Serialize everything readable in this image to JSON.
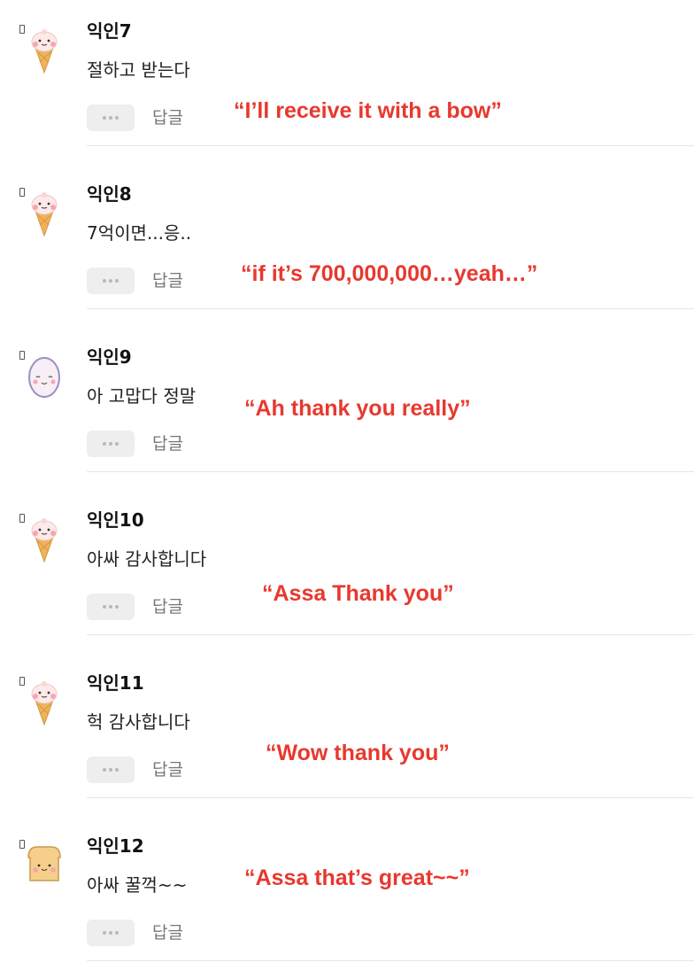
{
  "comments": [
    {
      "username": "익인7",
      "text": "절하고 받는다",
      "more_icon": "ellipsis-icon",
      "reply_label": "답글",
      "translation": "“I’ll receive it with a bow”",
      "avatar": "ice-cream-icon"
    },
    {
      "username": "익인8",
      "text": "7억이면...응..",
      "more_icon": "ellipsis-icon",
      "reply_label": "답글",
      "translation": "“if it’s 700,000,000…yeah…”",
      "avatar": "ice-cream-icon"
    },
    {
      "username": "익인9",
      "text": "아 고맙다 정말",
      "more_icon": "ellipsis-icon",
      "reply_label": "답글",
      "translation": "“Ah thank you really”",
      "avatar": "egg-icon"
    },
    {
      "username": "익인10",
      "text": "아싸 감사합니다",
      "more_icon": "ellipsis-icon",
      "reply_label": "답글",
      "translation": "“Assa Thank you”",
      "avatar": "ice-cream-icon"
    },
    {
      "username": "익인11",
      "text": "헉 감사합니다",
      "more_icon": "ellipsis-icon",
      "reply_label": "답글",
      "translation": "“Wow thank you”",
      "avatar": "ice-cream-icon"
    },
    {
      "username": "익인12",
      "text": "아싸 꿀꺽~~",
      "more_icon": "ellipsis-icon",
      "reply_label": "답글",
      "translation": "“Assa that’s great~~”",
      "avatar": "toast-icon"
    }
  ],
  "colors": {
    "translation": "#e8382e",
    "divider": "#e6e6e6",
    "button_bg": "#eeeeee"
  }
}
